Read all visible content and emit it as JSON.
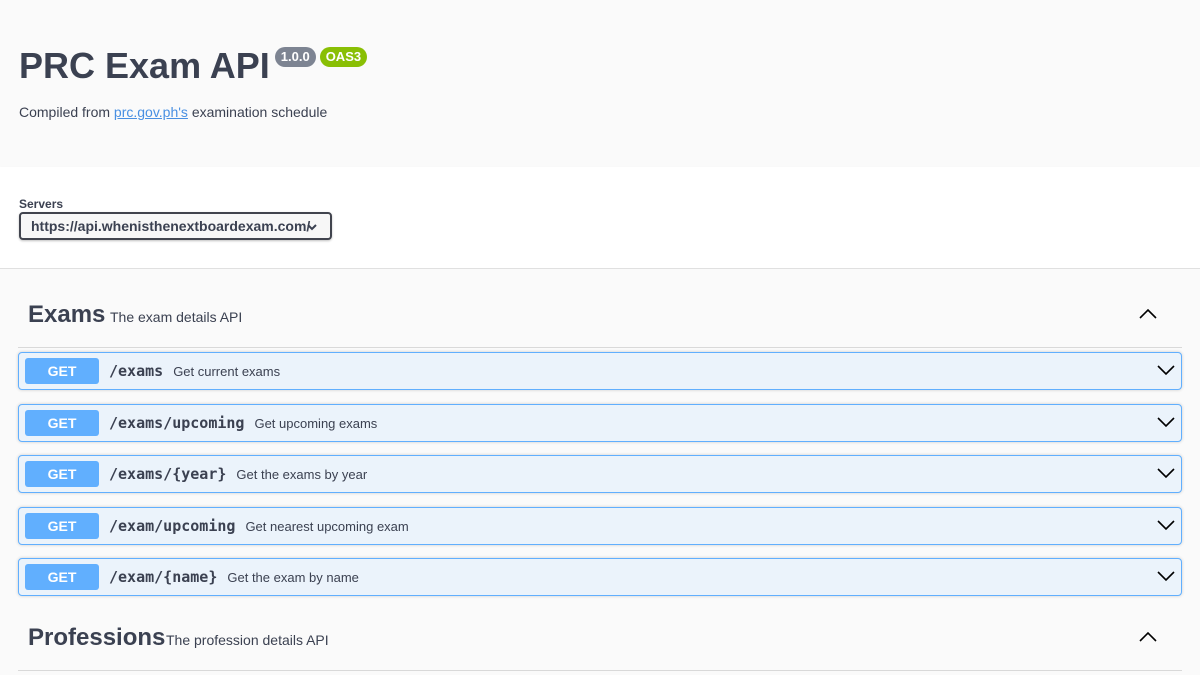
{
  "info": {
    "title": "PRC Exam API",
    "version": "1.0.0",
    "oas": "OAS3",
    "desc_prefix": "Compiled from ",
    "desc_link": "prc.gov.ph's",
    "desc_suffix": " examination schedule"
  },
  "servers": {
    "label": "Servers",
    "selected": "https://api.whenisthenextboardexam.com/"
  },
  "tags": [
    {
      "name": "Exams",
      "description": "The exam details API",
      "operations": [
        {
          "method": "GET",
          "path": "/exams",
          "summary": "Get current exams"
        },
        {
          "method": "GET",
          "path": "/exams/upcoming",
          "summary": "Get upcoming exams"
        },
        {
          "method": "GET",
          "path": "/exams/{year}",
          "summary": "Get the exams by year"
        },
        {
          "method": "GET",
          "path": "/exam/upcoming",
          "summary": "Get nearest upcoming exam"
        },
        {
          "method": "GET",
          "path": "/exam/{name}",
          "summary": "Get the exam by name"
        }
      ]
    },
    {
      "name": "Professions",
      "description": "The profession details API",
      "operations": []
    }
  ],
  "colors": {
    "get": "#61affe",
    "get_bg": "#ebf3fb",
    "version_badge": "#7d8492",
    "oas_badge": "#89bf04",
    "link": "#4990e2"
  }
}
